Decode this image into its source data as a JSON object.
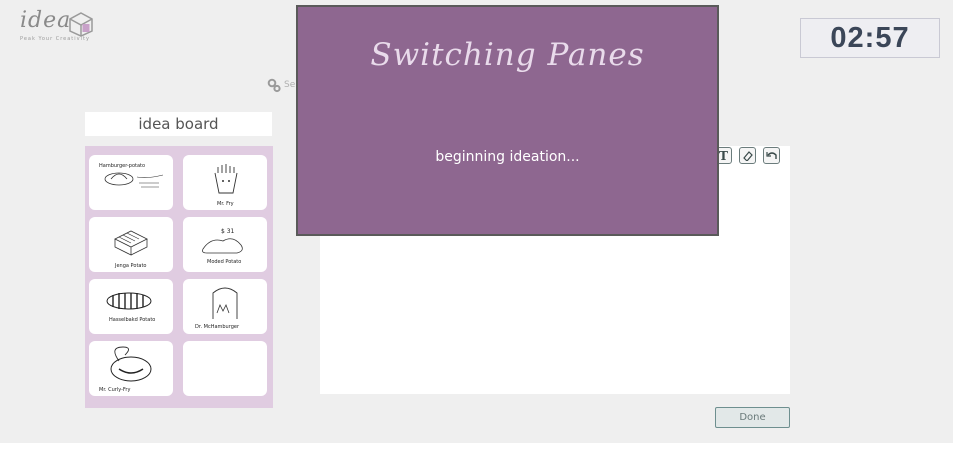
{
  "logo": {
    "word": "idea",
    "tagline": "Peak Your Creativity"
  },
  "timer": {
    "value": "02:57"
  },
  "settings": {
    "label": "Se"
  },
  "idea_board": {
    "title": "idea board",
    "cards": [
      {
        "caption": "Hamburger-potato"
      },
      {
        "caption": "Mr. Fry"
      },
      {
        "caption": "Jenga Potato"
      },
      {
        "caption": "Moded Potato"
      },
      {
        "caption": "Hasselbakd Potato"
      },
      {
        "caption": "Dr. McHamburger"
      },
      {
        "caption": "Mr. Curly-Fry"
      },
      {
        "caption": ""
      }
    ]
  },
  "tools": {
    "text_icon": "T"
  },
  "done_button": {
    "label": "Done"
  },
  "modal": {
    "title": "Switching Panes",
    "message": "beginning ideation..."
  },
  "colors": {
    "modal": "#8e6790",
    "board": "#e0cce1",
    "timer_text": "#3b4658"
  }
}
